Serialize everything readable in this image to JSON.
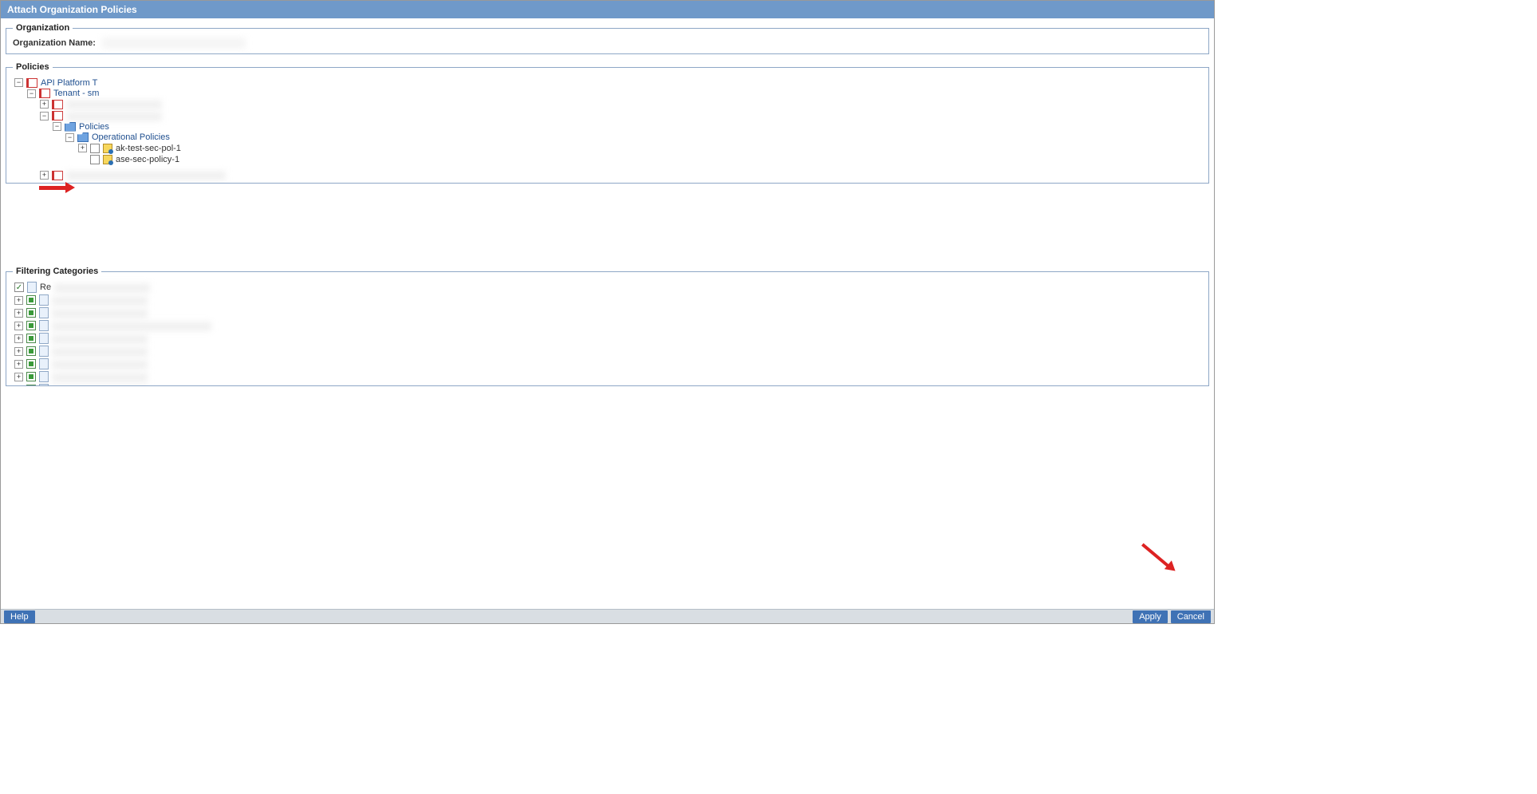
{
  "dialog": {
    "title": "Attach Organization Policies"
  },
  "organization": {
    "legend": "Organization",
    "name_label": "Organization Name:",
    "name_value": ""
  },
  "policies": {
    "legend": "Policies",
    "tree": {
      "root": "API Platform T",
      "tenant": "Tenant - sm",
      "policies_folder": "Policies",
      "operational_folder": "Operational Policies",
      "items": [
        {
          "label": "ak-test-sec-pol-1",
          "checked": false
        },
        {
          "label": "ase-sec-policy-1",
          "checked": false
        }
      ]
    }
  },
  "filtering": {
    "legend": "Filtering Categories",
    "items": [
      {
        "label": "Re",
        "checked": true,
        "type": "check"
      },
      {
        "label": "",
        "checked": true,
        "type": "square"
      },
      {
        "label": "",
        "checked": true,
        "type": "square"
      },
      {
        "label": "",
        "checked": true,
        "type": "square"
      },
      {
        "label": "",
        "checked": true,
        "type": "square"
      },
      {
        "label": "",
        "checked": true,
        "type": "square"
      },
      {
        "label": "",
        "checked": true,
        "type": "square"
      },
      {
        "label": "",
        "checked": true,
        "type": "square"
      },
      {
        "label": "",
        "checked": true,
        "type": "square"
      },
      {
        "label": "",
        "checked": true,
        "type": "square"
      }
    ]
  },
  "buttons": {
    "help": "Help",
    "apply": "Apply",
    "cancel": "Cancel"
  }
}
